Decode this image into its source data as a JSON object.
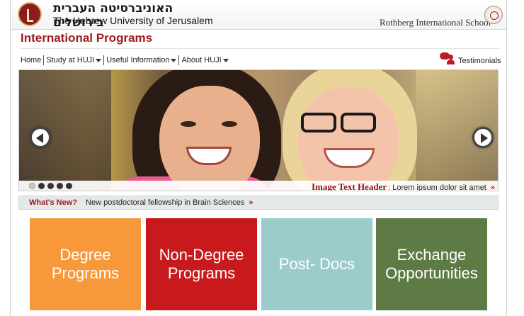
{
  "header": {
    "university_hebrew": "האוניברסיטה העברית בירושלים",
    "university_english": "The Hebrew University of Jerusalem",
    "school_name": "Rothberg International School"
  },
  "page_title": "International Programs",
  "nav": {
    "items": [
      {
        "label": "Home",
        "has_dropdown": false
      },
      {
        "label": "Study at HUJI",
        "has_dropdown": true
      },
      {
        "label": "Useful Information",
        "has_dropdown": true
      },
      {
        "label": "About HUJI",
        "has_dropdown": true
      }
    ],
    "testimonials_label": "Testimonials"
  },
  "slider": {
    "caption_header": "Image Text Header",
    "caption_text": ": Lorem ipsum dolor sit amet",
    "caption_more": "»",
    "dots": 5,
    "active_dot": 1
  },
  "whats_new": {
    "label": "What's New?",
    "text": "New postdoctoral fellowship in Brain Sciences",
    "more": "»"
  },
  "tiles": [
    {
      "label": "Degree\nPrograms",
      "color": "#f7993a"
    },
    {
      "label": "Non-Degree\nPrograms",
      "color": "#c8191c"
    },
    {
      "label": "Post- Docs",
      "color": "#9ccbcc"
    },
    {
      "label": "Exchange\nOpportunities",
      "color": "#5e7a45"
    }
  ],
  "colors": {
    "brand_red": "#a0191e",
    "nav_bar": "#e5e8e8"
  }
}
